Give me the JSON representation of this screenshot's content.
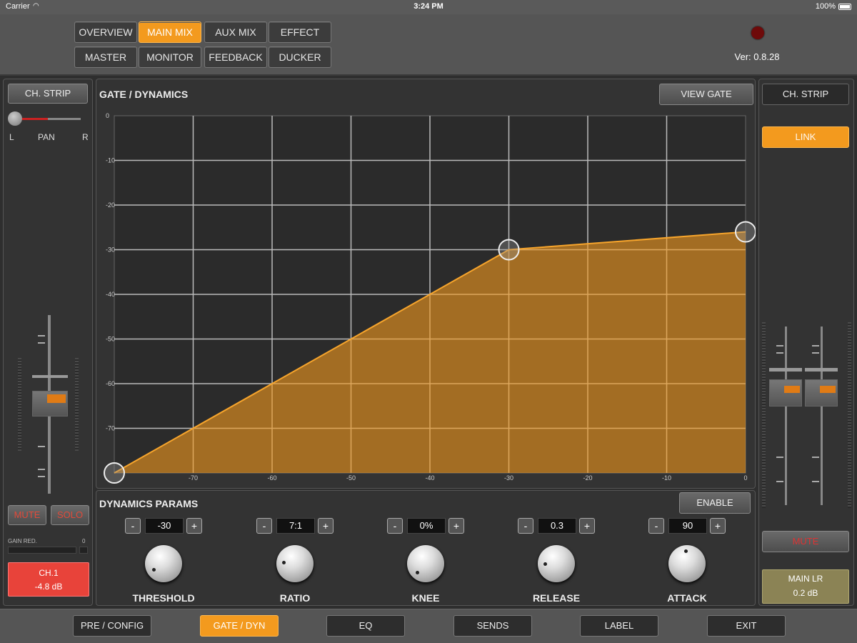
{
  "status": {
    "carrier": "Carrier",
    "time": "3:24 PM",
    "battery": "100%"
  },
  "nav": {
    "row1": [
      "OVERVIEW",
      "MAIN MIX",
      "AUX MIX",
      "EFFECT"
    ],
    "row2": [
      "MASTER",
      "MONITOR",
      "FEEDBACK",
      "DUCKER"
    ],
    "active": "MAIN MIX"
  },
  "version": "Ver: 0.8.28",
  "left_strip": {
    "ch_strip_label": "CH. STRIP",
    "pan_left": "L",
    "pan_label": "PAN",
    "pan_right": "R",
    "mute_label": "MUTE",
    "solo_label": "SOLO",
    "gain_red_label": "GAIN RED.",
    "gain_red_value": "0",
    "channel_name": "CH.1",
    "channel_level": "-4.8 dB"
  },
  "graph": {
    "title": "GATE / DYNAMICS",
    "view_gate_label": "VIEW GATE",
    "y_ticks": [
      "0",
      "-10",
      "-20",
      "-30",
      "-40",
      "-50",
      "-60",
      "-70"
    ],
    "x_ticks": [
      "-70",
      "-60",
      "-50",
      "-40",
      "-30",
      "-20",
      "-10",
      "0"
    ]
  },
  "chart_data": {
    "type": "area",
    "xlim": [
      -80,
      0
    ],
    "ylim": [
      -80,
      0
    ],
    "points": [
      {
        "x": -80,
        "y": -80
      },
      {
        "x": -30,
        "y": -30
      },
      {
        "x": 0,
        "y": -26
      }
    ],
    "handles": [
      {
        "x": -80,
        "y": -80
      },
      {
        "x": -30,
        "y": -30
      },
      {
        "x": 0,
        "y": -26
      }
    ],
    "grid": true,
    "fill_color": "#f39a1e"
  },
  "params": {
    "title": "DYNAMICS PARAMS",
    "enable_label": "ENABLE",
    "minus": "-",
    "plus": "+",
    "items": [
      {
        "label": "THRESHOLD",
        "value": "-30"
      },
      {
        "label": "RATIO",
        "value": "7:1"
      },
      {
        "label": "KNEE",
        "value": "0%"
      },
      {
        "label": "RELEASE",
        "value": "0.3"
      },
      {
        "label": "ATTACK",
        "value": "90"
      }
    ]
  },
  "right_strip": {
    "ch_strip_label": "CH. STRIP",
    "link_label": "LINK",
    "mute_label": "MUTE",
    "bus_name": "MAIN LR",
    "bus_level": "0.2 dB"
  },
  "bottom_tabs": [
    "PRE / CONFIG",
    "GATE / DYN",
    "EQ",
    "SENDS",
    "LABEL",
    "EXIT"
  ],
  "bottom_active": "GATE / DYN",
  "colors": {
    "accent": "#f39a1e",
    "mute_red": "#c22",
    "channel_red": "#e8433a",
    "bus_olive": "#8b8355"
  }
}
